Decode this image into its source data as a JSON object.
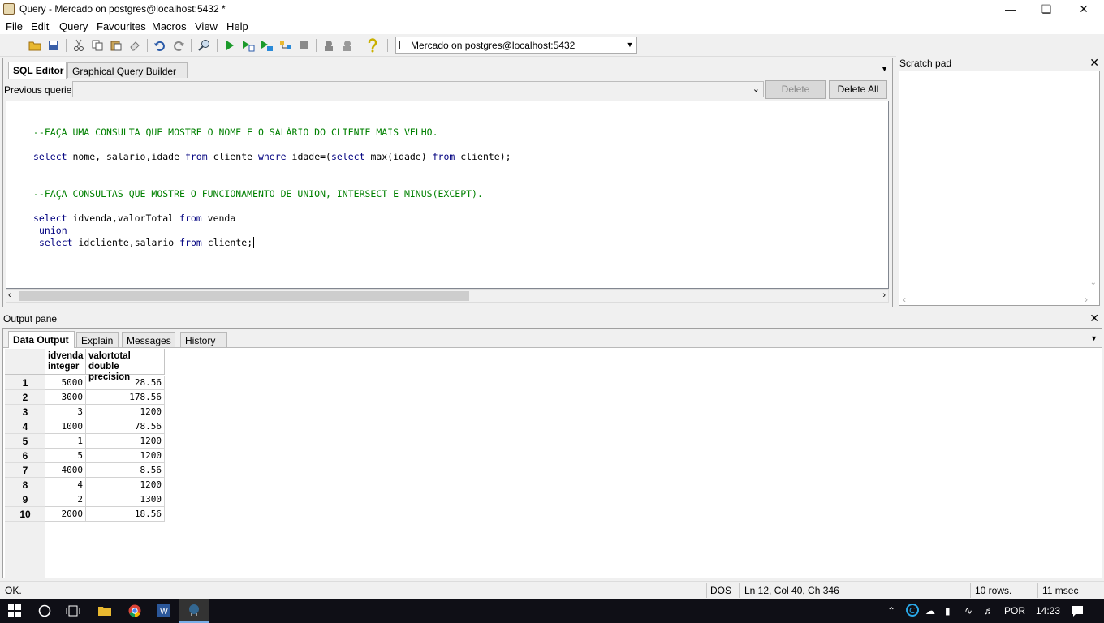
{
  "window": {
    "title": "Query - Mercado on postgres@localhost:5432 *"
  },
  "menu": [
    "File",
    "Edit",
    "Query",
    "Favourites",
    "Macros",
    "View",
    "Help"
  ],
  "toolbar": {
    "connection": "Mercado on postgres@localhost:5432"
  },
  "editor_tabs": [
    "SQL Editor",
    "Graphical Query Builder"
  ],
  "previous_queries": {
    "label": "Previous queries",
    "delete": "Delete",
    "delete_all": "Delete All"
  },
  "code": {
    "c1": "--FAÇA UMA CONSULTA QUE MOSTRE O NOME E O SALÁRIO DO CLIENTE MAIS VELHO.",
    "l2": [
      "select",
      " nome, salario,idade ",
      "from",
      " cliente ",
      "where",
      " idade=(",
      "select",
      " max(idade) ",
      "from",
      " cliente);"
    ],
    "c2": "--FAÇA CONSULTAS QUE MOSTRE O FUNCIONAMENTO DE UNION, INTERSECT E MINUS(EXCEPT).",
    "l4": [
      "select",
      " idvenda,valorTotal ",
      "from",
      " venda"
    ],
    "l5": [
      "union"
    ],
    "l6": [
      "select",
      " idcliente,salario ",
      "from",
      " cliente;"
    ]
  },
  "scratch_pad": {
    "title": "Scratch pad"
  },
  "output_pane": {
    "title": "Output pane",
    "tabs": [
      "Data Output",
      "Explain",
      "Messages",
      "History"
    ]
  },
  "grid": {
    "columns": [
      {
        "name": "idvenda",
        "type": "integer"
      },
      {
        "name": "valortotal",
        "type": "double precision"
      }
    ],
    "rows": [
      [
        "1",
        "5000",
        "28.56"
      ],
      [
        "2",
        "3000",
        "178.56"
      ],
      [
        "3",
        "3",
        "1200"
      ],
      [
        "4",
        "1000",
        "78.56"
      ],
      [
        "5",
        "1",
        "1200"
      ],
      [
        "6",
        "5",
        "1200"
      ],
      [
        "7",
        "4000",
        "8.56"
      ],
      [
        "8",
        "4",
        "1200"
      ],
      [
        "9",
        "2",
        "1300"
      ],
      [
        "10",
        "2000",
        "18.56"
      ]
    ]
  },
  "status": {
    "msg": "OK.",
    "mode": "DOS",
    "pos": "Ln 12, Col 40, Ch 346",
    "rows": "10 rows.",
    "time": "11 msec"
  },
  "taskbar": {
    "lang": "POR",
    "clock": "14:23"
  }
}
